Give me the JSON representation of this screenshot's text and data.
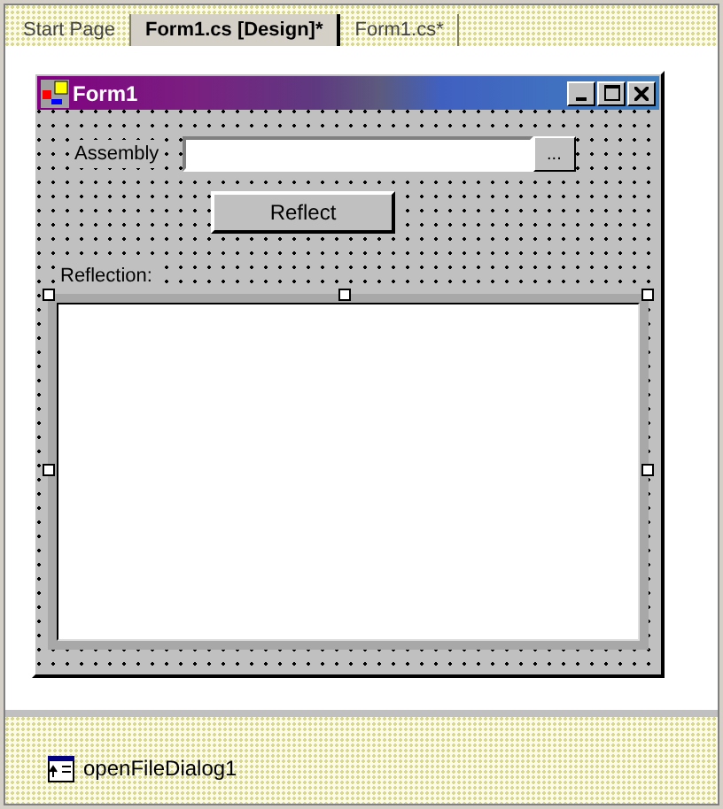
{
  "tabs": [
    {
      "label": "Start Page",
      "selected": false
    },
    {
      "label": "Form1.cs [Design]*",
      "selected": true
    },
    {
      "label": "Form1.cs*",
      "selected": false
    }
  ],
  "form": {
    "title": "Form1",
    "assembly_label": "Assembly",
    "browse_button": "...",
    "reflect_button": "Reflect",
    "reflection_label": "Reflection:",
    "list_selected": true
  },
  "component_tray": [
    {
      "name": "openFileDialog1"
    }
  ]
}
